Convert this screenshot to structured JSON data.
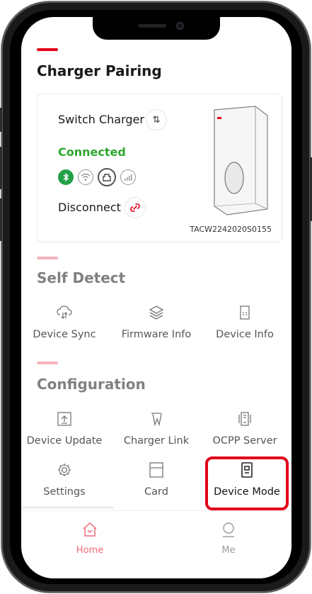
{
  "charger_pairing": {
    "title": "Charger Pairing",
    "switch_label": "Switch Charger",
    "status": "Connected",
    "disconnect_label": "Disconnect",
    "serial": "TACW2242020S0155",
    "connection_icons": [
      "bluetooth-icon",
      "wifi-icon",
      "ethernet-icon",
      "cellular-icon"
    ]
  },
  "self_detect": {
    "title": "Self Detect",
    "items": [
      {
        "label": "Device Sync",
        "icon": "sync-icon"
      },
      {
        "label": "Firmware Info",
        "icon": "layers-icon"
      },
      {
        "label": "Device Info",
        "icon": "device-info-icon"
      }
    ]
  },
  "configuration": {
    "title": "Configuration",
    "items": [
      {
        "label": "Device Update",
        "icon": "upload-icon"
      },
      {
        "label": "Charger Link",
        "icon": "link-icon"
      },
      {
        "label": "OCPP Server",
        "icon": "server-icon"
      },
      {
        "label": "Settings",
        "icon": "gear-icon"
      },
      {
        "label": "Card",
        "icon": "card-icon"
      },
      {
        "label": "Device Mode",
        "icon": "device-mode-icon"
      }
    ]
  },
  "tabs": [
    {
      "label": "Home",
      "icon": "home-icon",
      "active": true
    },
    {
      "label": "Me",
      "icon": "user-icon",
      "active": false
    }
  ],
  "colors": {
    "accent": "#e2001a",
    "connected": "#2ea62e",
    "highlight": "#e2001a",
    "tab_active": "#f06a78",
    "tab_inactive": "#9a9a9a"
  }
}
